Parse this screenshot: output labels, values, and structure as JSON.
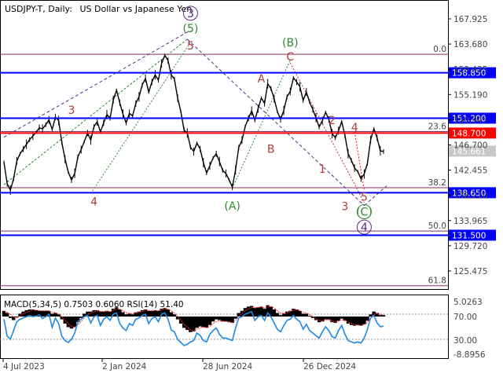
{
  "title": {
    "symbol": "USDJPY-T, Daily:",
    "description": "US Dollar vs Japanese Yen"
  },
  "indicator_label": "MACD(5,34,5) 0.7503 0.6060 RSI(14) 51.40",
  "colors": {
    "price": "#000000",
    "hline_blue": "#0000ff",
    "hline_red": "#ff0000",
    "fib": "#8b2d6a",
    "wave_red": "#b33a3a",
    "wave_green": "#2e8b2e",
    "wave_purple": "#5b2a86",
    "rsi": "#1e88e5",
    "macd": "#000000"
  },
  "chart_data": {
    "type": "line",
    "title": "USDJPY-T, Daily:  US Dollar vs Japanese Yen",
    "price_axis": {
      "ticks": [
        167.925,
        163.68,
        159.435,
        155.19,
        150.945,
        146.7,
        142.455,
        138.21,
        133.965,
        129.72,
        125.475
      ]
    },
    "x_ticks": [
      "4 Jul 2023",
      "2 Jan 2024",
      "28 Jun 2024",
      "26 Dec 2024"
    ],
    "price_series": [
      143.8,
      140.2,
      139.1,
      141.0,
      144.0,
      145.2,
      146.0,
      146.8,
      147.6,
      148.2,
      148.8,
      149.6,
      149.4,
      150.1,
      150.9,
      149.3,
      151.4,
      150.8,
      147.1,
      144.3,
      142.1,
      140.8,
      141.9,
      144.7,
      145.9,
      147.3,
      148.7,
      147.5,
      149.8,
      150.6,
      148.9,
      150.4,
      151.8,
      151.2,
      154.3,
      155.9,
      153.8,
      151.9,
      150.4,
      152.0,
      151.6,
      153.7,
      154.8,
      156.8,
      157.9,
      155.6,
      157.3,
      158.5,
      157.6,
      160.4,
      161.8,
      160.9,
      158.5,
      157.8,
      154.6,
      152.3,
      149.2,
      148.7,
      146.3,
      145.6,
      147.0,
      146.0,
      143.7,
      142.0,
      143.2,
      144.5,
      145.2,
      143.9,
      142.4,
      141.9,
      140.8,
      139.6,
      142.5,
      146.3,
      147.5,
      149.8,
      151.2,
      152.4,
      150.9,
      152.8,
      154.6,
      153.7,
      157.0,
      156.2,
      154.5,
      152.3,
      151.0,
      152.5,
      154.8,
      155.7,
      158.0,
      157.3,
      156.5,
      154.2,
      155.6,
      153.9,
      152.7,
      151.3,
      149.7,
      150.8,
      152.2,
      151.0,
      148.6,
      147.9,
      149.1,
      150.6,
      148.3,
      145.2,
      144.1,
      142.8,
      142.2,
      141.0,
      141.8,
      143.6,
      147.6,
      149.4,
      147.9,
      145.7,
      145.6
    ],
    "macd_hist": [
      0.8,
      0.5,
      -0.2,
      -0.5,
      -0.1,
      0.4,
      0.7,
      0.9,
      1.0,
      1.0,
      0.9,
      0.8,
      0.8,
      0.8,
      0.8,
      0.4,
      0.5,
      0.3,
      -0.4,
      -1.0,
      -1.5,
      -1.7,
      -1.5,
      -0.8,
      -0.2,
      0.4,
      0.7,
      0.7,
      0.9,
      0.9,
      0.7,
      0.7,
      0.8,
      0.7,
      1.1,
      1.3,
      1.0,
      0.6,
      0.3,
      0.4,
      0.3,
      0.6,
      0.7,
      0.9,
      1.0,
      0.8,
      0.8,
      0.9,
      0.8,
      1.1,
      1.2,
      1.0,
      0.6,
      0.3,
      -0.4,
      -1.0,
      -1.6,
      -1.9,
      -2.2,
      -2.1,
      -1.6,
      -1.4,
      -1.5,
      -1.6,
      -1.2,
      -0.7,
      -0.4,
      -0.5,
      -0.7,
      -0.7,
      -0.8,
      -0.9,
      -0.3,
      0.5,
      0.8,
      1.2,
      1.4,
      1.5,
      1.2,
      1.3,
      1.4,
      1.1,
      1.6,
      1.4,
      1.0,
      0.5,
      0.2,
      0.4,
      0.7,
      0.8,
      1.1,
      1.0,
      0.8,
      0.4,
      0.4,
      0.1,
      -0.2,
      -0.5,
      -0.8,
      -0.7,
      -0.4,
      -0.4,
      -0.8,
      -0.9,
      -0.6,
      -0.3,
      -0.6,
      -1.0,
      -1.2,
      -1.3,
      -1.2,
      -1.3,
      -1.1,
      -0.6,
      0.3,
      0.7,
      0.5,
      0.2,
      0.2
    ],
    "macd_signal": [
      0.7,
      0.6,
      0.3,
      -0.1,
      -0.2,
      0.1,
      0.4,
      0.6,
      0.8,
      0.9,
      0.9,
      0.85,
      0.8,
      0.8,
      0.8,
      0.6,
      0.55,
      0.4,
      0.0,
      -0.5,
      -1.0,
      -1.4,
      -1.5,
      -1.2,
      -0.7,
      -0.1,
      0.3,
      0.5,
      0.7,
      0.8,
      0.75,
      0.7,
      0.75,
      0.7,
      0.9,
      1.1,
      1.05,
      0.8,
      0.55,
      0.45,
      0.4,
      0.5,
      0.6,
      0.75,
      0.9,
      0.85,
      0.8,
      0.85,
      0.8,
      0.95,
      1.1,
      1.05,
      0.8,
      0.5,
      0.0,
      -0.5,
      -1.1,
      -1.5,
      -1.9,
      -2.0,
      -1.8,
      -1.6,
      -1.5,
      -1.55,
      -1.4,
      -1.0,
      -0.7,
      -0.6,
      -0.65,
      -0.7,
      -0.75,
      -0.85,
      -0.55,
      0.0,
      0.4,
      0.8,
      1.1,
      1.3,
      1.25,
      1.3,
      1.35,
      1.2,
      1.4,
      1.4,
      1.2,
      0.8,
      0.5,
      0.45,
      0.55,
      0.7,
      0.9,
      0.95,
      0.85,
      0.6,
      0.5,
      0.3,
      0.0,
      -0.3,
      -0.55,
      -0.6,
      -0.5,
      -0.45,
      -0.6,
      -0.75,
      -0.65,
      -0.45,
      -0.55,
      -0.8,
      -1.0,
      -1.15,
      -1.2,
      -1.25,
      -1.15,
      -0.8,
      -0.2,
      0.3,
      0.4,
      0.3,
      0.25
    ],
    "rsi_series": [
      62,
      35,
      30,
      44,
      58,
      62,
      64,
      66,
      68,
      66,
      67,
      69,
      63,
      66,
      70,
      49,
      64,
      55,
      35,
      28,
      25,
      30,
      40,
      58,
      62,
      66,
      68,
      56,
      66,
      68,
      52,
      62,
      66,
      60,
      70,
      72,
      55,
      48,
      44,
      55,
      52,
      62,
      64,
      68,
      70,
      55,
      63,
      66,
      58,
      70,
      72,
      62,
      45,
      42,
      30,
      25,
      20,
      22,
      26,
      28,
      40,
      36,
      28,
      26,
      38,
      44,
      48,
      38,
      32,
      32,
      30,
      28,
      48,
      64,
      66,
      70,
      72,
      74,
      60,
      66,
      68,
      60,
      72,
      66,
      56,
      46,
      42,
      52,
      60,
      62,
      68,
      62,
      58,
      46,
      54,
      44,
      40,
      36,
      32,
      42,
      50,
      44,
      34,
      32,
      44,
      52,
      38,
      28,
      26,
      24,
      26,
      24,
      32,
      46,
      64,
      68,
      56,
      50,
      51
    ],
    "horizontal_levels": [
      {
        "price": 158.85,
        "label": "158.850",
        "style": "blue"
      },
      {
        "price": 151.2,
        "label": "151.200",
        "style": "blue"
      },
      {
        "price": 148.7,
        "label": "148.700",
        "style": "red"
      },
      {
        "price": 138.65,
        "label": "138.650",
        "style": "blue"
      },
      {
        "price": 131.5,
        "label": "131.500",
        "style": "blue"
      }
    ],
    "current_price": {
      "price": 145.661,
      "label": "145.661"
    },
    "fibonacci": [
      {
        "level": "0.0",
        "price": 161.95
      },
      {
        "level": "23.6",
        "price": 148.95
      },
      {
        "level": "38.2",
        "price": 139.5
      },
      {
        "level": "50.0",
        "price": 132.2
      },
      {
        "level": "61.8",
        "price": 123.0
      }
    ],
    "wave_labels": [
      {
        "text": "3",
        "bar": 21,
        "price": 151.9,
        "color": "red"
      },
      {
        "text": "4",
        "bar": 28,
        "price": 136.5,
        "color": "red"
      },
      {
        "text": "5",
        "bar": 58,
        "price": 162.8,
        "color": "red"
      },
      {
        "text": "(5)",
        "bar": 58,
        "price": 165.7,
        "color": "green"
      },
      {
        "text": "3",
        "bar": 58,
        "price": 168.2,
        "color": "purple",
        "circle": true
      },
      {
        "text": "(A)",
        "bar": 71,
        "price": 135.8,
        "color": "green"
      },
      {
        "text": "A",
        "bar": 80,
        "price": 157.2,
        "color": "red"
      },
      {
        "text": "B",
        "bar": 83,
        "price": 145.4,
        "color": "red"
      },
      {
        "text": "C",
        "bar": 89,
        "price": 160.9,
        "color": "red"
      },
      {
        "text": "(B)",
        "bar": 89,
        "price": 163.3,
        "color": "green"
      },
      {
        "text": "1",
        "bar": 99,
        "price": 142.0,
        "color": "red"
      },
      {
        "text": "2",
        "bar": 102,
        "price": 150.2,
        "color": "red"
      },
      {
        "text": "3",
        "bar": 106,
        "price": 135.7,
        "color": "red"
      },
      {
        "text": "4",
        "bar": 109,
        "price": 149.0,
        "color": "red"
      },
      {
        "text": "5",
        "bar": 112,
        "price": 137.3,
        "color": "red"
      },
      {
        "text": "(C)",
        "bar": 112,
        "price": 134.8,
        "color": "green",
        "circle": true
      },
      {
        "text": "4",
        "bar": 112,
        "price": 132.2,
        "color": "purple",
        "circle": true
      }
    ],
    "indicator_axis": {
      "ticks": [
        "5.0263",
        "70.00",
        "30.00",
        "-8.8956"
      ]
    }
  }
}
